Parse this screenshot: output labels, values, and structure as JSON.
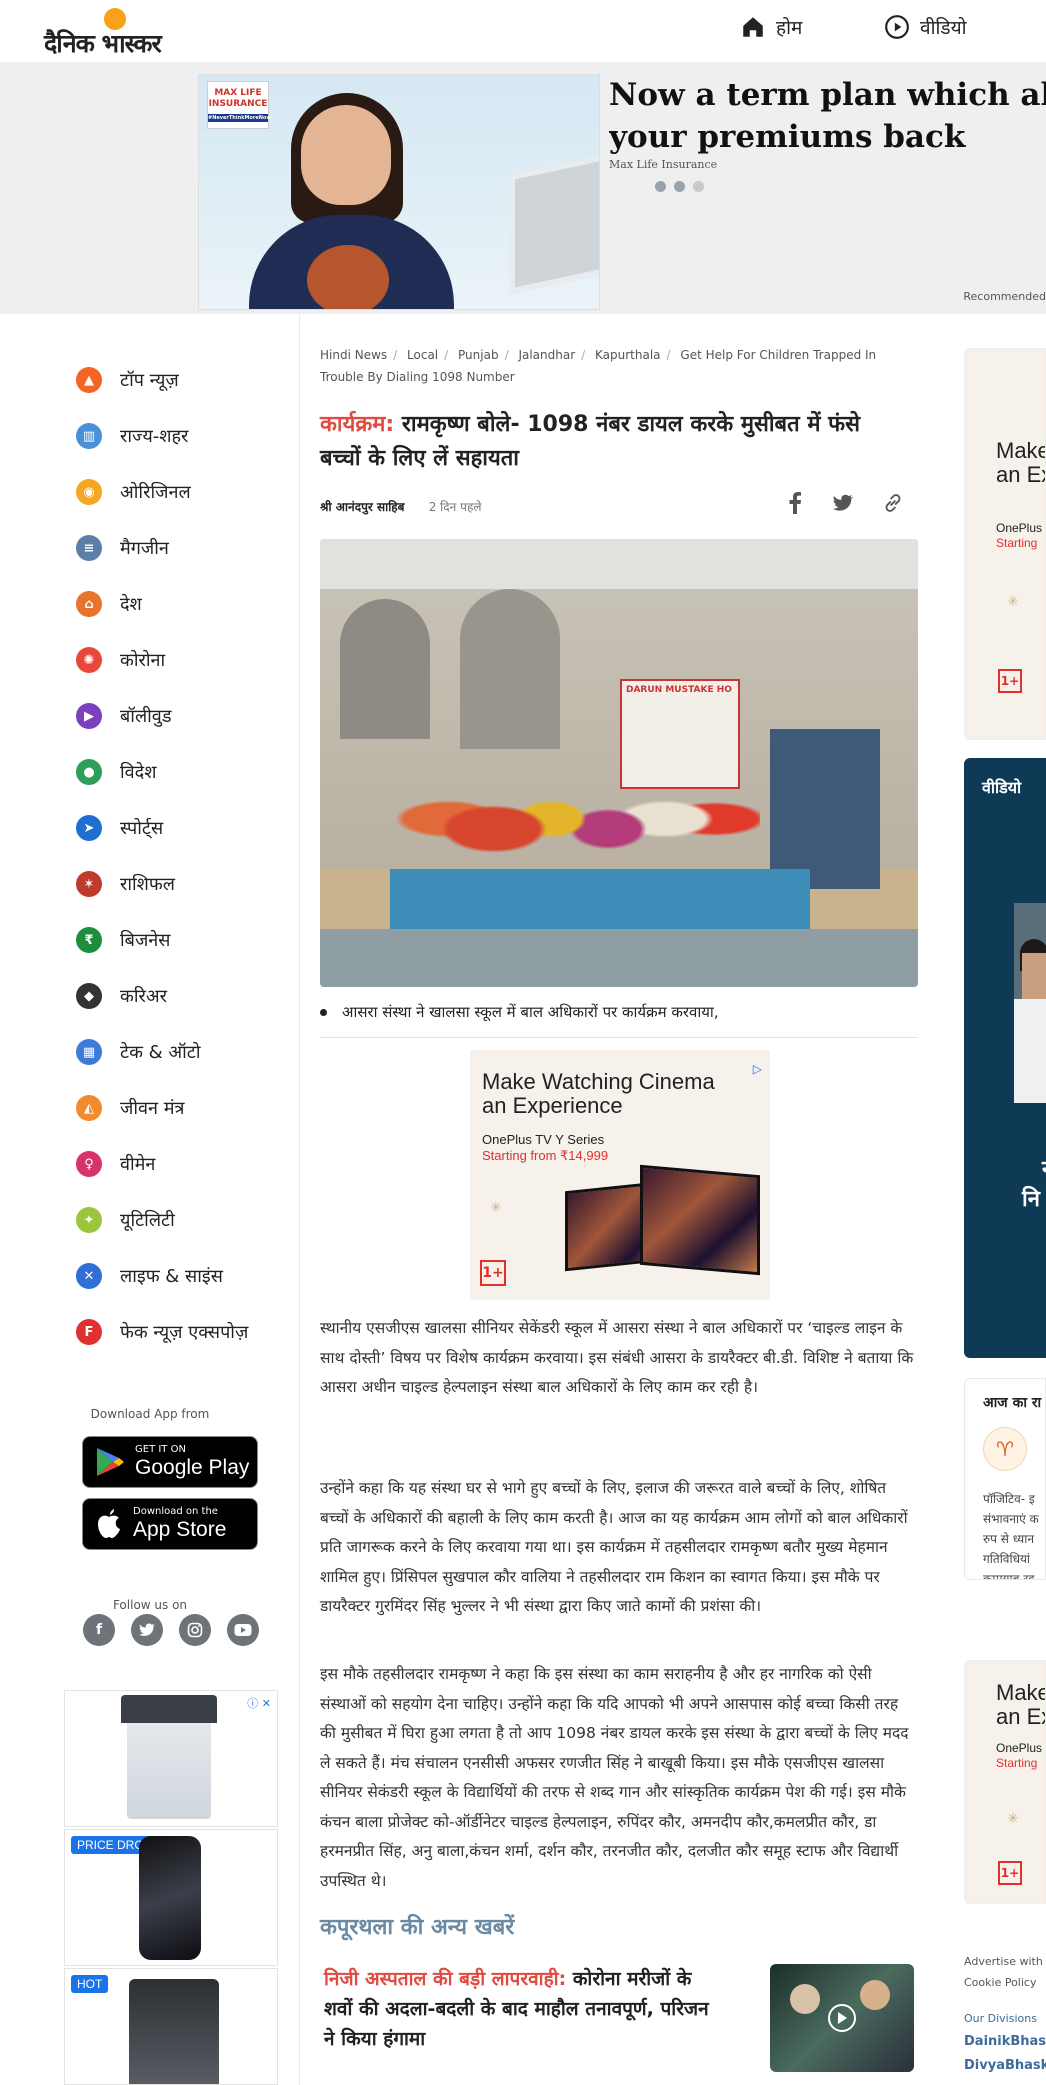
{
  "header": {
    "logo_text": "दैनिक भास्कर",
    "nav": [
      {
        "label": "होम",
        "icon": "home-icon"
      },
      {
        "label": "वीडियो",
        "icon": "play-circle-icon"
      }
    ]
  },
  "banner_ad": {
    "brand": "MAX LIFE INSURANCE",
    "hashtag": "#NeverThinkMoreNow",
    "headline_1": "Now a term plan which also gi",
    "headline_2": "your premiums back",
    "sponsor": "Max Life Insurance",
    "recommended": "Recommended"
  },
  "sidebar": {
    "items": [
      {
        "label": "टॉप न्यूज़",
        "icon": "fire-icon",
        "color": "#f26522"
      },
      {
        "label": "राज्य-शहर",
        "icon": "city-icon",
        "color": "#4a90d9"
      },
      {
        "label": "ओरिजिनल",
        "icon": "original-icon",
        "color": "#f5a623"
      },
      {
        "label": "मैगजीन",
        "icon": "magazine-icon",
        "color": "#5b7fa6"
      },
      {
        "label": "देश",
        "icon": "gate-icon",
        "color": "#e8742c"
      },
      {
        "label": "कोरोना",
        "icon": "virus-icon",
        "color": "#e8473c"
      },
      {
        "label": "बॉलीवुड",
        "icon": "clapperboard-icon",
        "color": "#7b3fbf"
      },
      {
        "label": "विदेश",
        "icon": "globe-icon",
        "color": "#2e9e5b"
      },
      {
        "label": "स्पोर्ट्स",
        "icon": "runner-icon",
        "color": "#1f6fd1"
      },
      {
        "label": "राशिफल",
        "icon": "zodiac-icon",
        "color": "#c0392b"
      },
      {
        "label": "बिजनेस",
        "icon": "rupee-icon",
        "color": "#1e8e3e"
      },
      {
        "label": "करिअर",
        "icon": "graduation-cap-icon",
        "color": "#333333"
      },
      {
        "label": "टेक & ऑटो",
        "icon": "car-phone-icon",
        "color": "#3d7bd9"
      },
      {
        "label": "जीवन मंत्र",
        "icon": "lamp-icon",
        "color": "#f08c2e"
      },
      {
        "label": "वीमेन",
        "icon": "women-icon",
        "color": "#d6336c"
      },
      {
        "label": "यूटिलिटी",
        "icon": "bulb-icon",
        "color": "#9bc53d"
      },
      {
        "label": "लाइफ & साइंस",
        "icon": "dna-icon",
        "color": "#2f6fd6"
      },
      {
        "label": "फेक न्यूज़ एक्सपोज़",
        "icon": "fake-icon",
        "color": "#e03131"
      }
    ],
    "download_label": "Download App from",
    "google_play": {
      "small": "GET IT ON",
      "big": "Google Play"
    },
    "app_store": {
      "small": "Download on the",
      "big": "App Store"
    },
    "follow_label": "Follow us on",
    "ad_badges": [
      "PRICE DROP",
      "HOT"
    ]
  },
  "article": {
    "breadcrumbs": [
      "Hindi News",
      "Local",
      "Punjab",
      "Jalandhar",
      "Kapurthala"
    ],
    "breadcrumb_current": "Get Help For Children Trapped In Trouble By Dialing 1098 Number",
    "kicker": "कार्यक्रम:",
    "title": "रामकृष्ण बोले- 1098 नंबर डायल करके मुसीबत में फंसे बच्चों के लिए लें सहायता",
    "location": "श्री आनंदपुर साहिब",
    "time": "2 दिन पहले",
    "photo_banner_text": "DARUN MUSTAKE HO",
    "caption": "आसरा संस्था ने खालसा स्कूल में बाल अधिकारों पर कार्यक्रम करवाया,",
    "inline_ad": {
      "title_1": "Make Watching Cinema",
      "title_2": "an Experience",
      "sub": "OnePlus TV Y Series",
      "price": "Starting from ₹14,999"
    },
    "paragraphs": [
      "स्थानीय एसजीएस खालसा सीनियर सेकेंडरी स्कूल में आसरा संस्था ने बाल अधिकारों पर ‘चाइल्ड लाइन के साथ दोस्ती’ विषय पर विशेष कार्यक्रम करवाया। इस संबंधी आसरा के डायरैक्टर बी.डी. विशिष्ट ने बताया कि आसरा अधीन चाइल्ड हेल्पलाइन संस्था बाल अधिकारों के लिए काम कर रही है।",
      "उन्होंने कहा कि यह संस्था घर से भागे हुए बच्चों के लिए, इलाज की जरूरत वाले बच्चों के लिए, शोषित बच्चों के अधिकारों की बहाली के लिए काम करती है। आज का यह कार्यक्रम आम लोगों को बाल अधिकारों प्रति जागरूक करने के लिए करवाया गया था। इस कार्यक्रम में तहसीलदार रामकृष्ण बतौर मुख्य मेहमान शामिल हुए। प्रिंसिपल सुखपाल कौर वालिया ने तहसीलदार राम किशन का स्वागत किया। इस मौके पर डायरैक्टर गुरमिंदर सिंह भुल्लर ने भी संस्था द्वारा किए जाते कामों की प्रशंसा की।",
      "इस मौके तहसीलदार रामकृष्ण ने कहा कि इस संस्था का काम सराहनीय है और हर नागरिक को ऐसी संस्थाओं को सहयोग देना चाहिए। उन्होंने कहा कि यदि आपको भी अपने आसपास कोई बच्चा किसी तरह की मुसीबत में घिरा हुआ लगता है तो आप 1098 नंबर डायल करके इस संस्था के द्वारा बच्चों के लिए मदद ले सकते हैं। मंच संचालन एनसीसी अफसर रणजीत सिंह ने बाखूबी किया। इस मौके एसजीएस खालसा सीनियर सेकंडरी स्कूल के विद्यार्थियों की तरफ से शब्द गान और सांस्कृतिक कार्यक्रम पेश की गई। इस मौके कंचन बाला प्रोजेक्ट को-ऑर्डीनेटर चाइल्ड हेल्पलाइन, रुपिंदर कौर, अमनदीप कौर,कमलप्रीत कौर, डा हरमनप्रीत सिंह, अनु बाला,कंचन शर्मा, दर्शन कौर, तरनजीत कौर, दलजीत कौर समूह स्टाफ और विद्यार्थी उपस्थित थे।"
    ],
    "more_news_title": "कपूरथला की अन्य खबरें",
    "related": {
      "kicker": "निजी अस्पताल की बड़ी लापरवाही:",
      "title": "कोरोना मरीजों के शवों की अदला-बदली के बाद माहौल तनावपूर्ण, परिजन ने किया हंगामा"
    }
  },
  "right_rail": {
    "ad1_title_1": "Make",
    "ad1_title_2": "an Ex",
    "ad1_sub": "OnePlus",
    "ad1_price": "Starting",
    "video_label": "वीडियो",
    "video_text_1": "न",
    "video_text_2": "नि",
    "rashifal_label": "आज का रा",
    "rashifal_lines": [
      "पॉजिटिव- इ",
      "संभावनाएं क",
      "रुप से ध्यान",
      "गतिविधियां",
      "कामयाब रह"
    ],
    "ad2_title_1": "Make",
    "ad2_title_2": "an Ex",
    "ad2_sub": "OnePlus",
    "ad2_price": "Starting",
    "footer_links": [
      "Advertise with U",
      "Cookie Policy"
    ],
    "our_divisions": "Our Divisions",
    "divisions": [
      "DainikBhask",
      "DivyaBhaska"
    ]
  }
}
